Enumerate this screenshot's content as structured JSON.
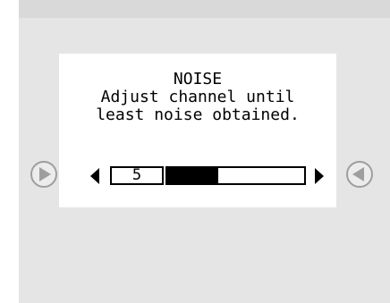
{
  "dialog": {
    "title": "NOISE",
    "message_line1": "Adjust channel until",
    "message_line2": "least noise obtained."
  },
  "channel": {
    "value": "5",
    "level_fraction": 0.37
  },
  "icons": {
    "prev": "play-left-icon",
    "next": "play-right-icon",
    "decrease": "triangle-left-icon",
    "increase": "triangle-right-icon"
  },
  "colors": {
    "background": "#e5e5e5",
    "panel": "#ffffff",
    "ink": "#000000",
    "button_border": "#9e9e9e"
  }
}
